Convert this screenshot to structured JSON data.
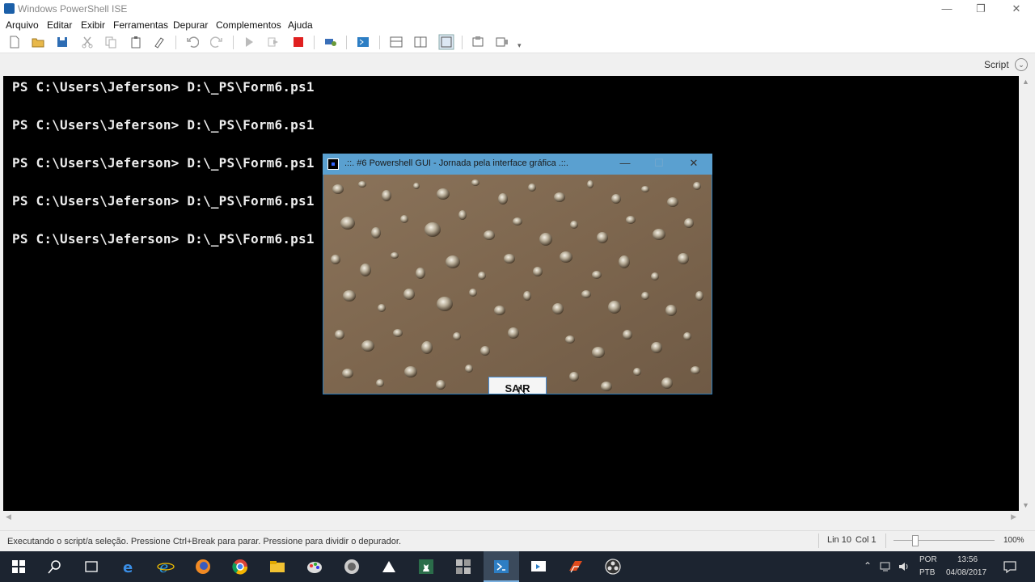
{
  "window": {
    "title": "Windows PowerShell ISE"
  },
  "menu": {
    "items": [
      "Arquivo",
      "Editar",
      "Exibir",
      "Ferramentas",
      "Depurar",
      "Complementos",
      "Ajuda"
    ]
  },
  "pane": {
    "script_label": "Script"
  },
  "console": {
    "lines": [
      "PS C:\\Users\\Jeferson> D:\\_PS\\Form6.ps1",
      "PS C:\\Users\\Jeferson> D:\\_PS\\Form6.ps1",
      "PS C:\\Users\\Jeferson> D:\\_PS\\Form6.ps1",
      "PS C:\\Users\\Jeferson> D:\\_PS\\Form6.ps1",
      "PS C:\\Users\\Jeferson> D:\\_PS\\Form6.ps1"
    ]
  },
  "dialog": {
    "title": ".::. #6 Powershell GUI - Jornada pela interface gráfica .::.",
    "button_label": "SAIR"
  },
  "status": {
    "message": "Executando o script/a seleção. Pressione Ctrl+Break para parar. Pressione  para dividir o depurador.",
    "line": "Lin 10",
    "col": "Col 1",
    "zoom": "100%"
  },
  "tray": {
    "lang1": "POR",
    "lang2": "PTB",
    "time": "13:56",
    "date": "04/08/2017"
  },
  "colors": {
    "console_bg": "#000000",
    "dialog_title": "#5aa0d0",
    "taskbar": "#1c2430"
  }
}
